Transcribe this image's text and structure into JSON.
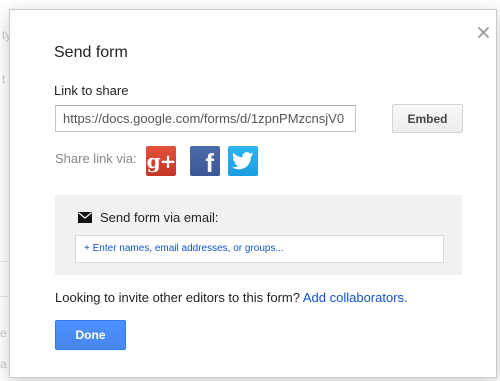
{
  "background_fragments": [
    "ty",
    "t",
    "e",
    "a"
  ],
  "dialog": {
    "title": "Send form",
    "close_glyph": "×",
    "link": {
      "label": "Link to share",
      "value": "https://docs.google.com/forms/d/1zpnPMzcnsjV0",
      "embed_label": "Embed"
    },
    "share": {
      "label": "Share link via:",
      "networks": [
        {
          "name": "google-plus",
          "glyph": "g+"
        },
        {
          "name": "facebook",
          "glyph": "f"
        },
        {
          "name": "twitter",
          "glyph": "twitter-bird"
        }
      ]
    },
    "email": {
      "heading": "Send form via email:",
      "placeholder": "+ Enter names, email addresses, or groups..."
    },
    "invite": {
      "text": "Looking to invite other editors to this form?",
      "link_label": "Add collaborators."
    },
    "done_label": "Done"
  },
  "colors": {
    "primary_blue": "#4d90fe",
    "link_blue": "#1155cc",
    "google_plus_red": "#dd4b39",
    "facebook_blue": "#3b5998",
    "twitter_blue": "#2aa9e0"
  }
}
